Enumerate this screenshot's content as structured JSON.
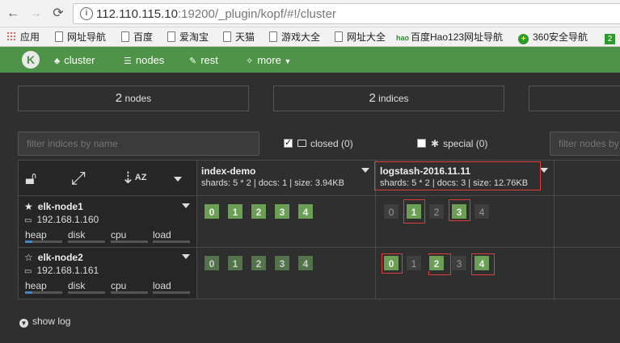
{
  "browser": {
    "url_host": "112.110.115.10",
    "url_rest": ":19200/_plugin/kopf/#!/cluster",
    "bookmarks": [
      "应用",
      "网址导航",
      "百度",
      "爱淘宝",
      "天猫",
      "游戏大全",
      "网址大全",
      "百度Hao123网址导航",
      "360安全导航"
    ],
    "hao_badge": "hao",
    "s360_badge": "+",
    "s2_badge": "2"
  },
  "navbar": {
    "logo": "K",
    "items": [
      {
        "label": "cluster",
        "icon": "sitemap-icon"
      },
      {
        "label": "nodes",
        "icon": "list-icon"
      },
      {
        "label": "rest",
        "icon": "edit-icon"
      },
      {
        "label": "more",
        "icon": "magic-wand-icon"
      }
    ]
  },
  "stats": {
    "nodes_count": "2",
    "nodes_label": "nodes",
    "indices_count": "2",
    "indices_label": "indices"
  },
  "filters": {
    "indices_placeholder": "filter indices by name",
    "closed_label": "closed (0)",
    "special_label": "special (0)",
    "nodes_placeholder": "filter nodes by"
  },
  "indices": [
    {
      "name": "index-demo",
      "meta": "shards: 5 * 2 | docs: 1 | size: 3.94KB"
    },
    {
      "name": "logstash-2016.11.11",
      "meta": "shards: 5 * 2 | docs: 3 | size: 12.76KB"
    }
  ],
  "metric_labels": [
    "heap",
    "disk",
    "cpu",
    "load"
  ],
  "nodes": [
    {
      "name": "elk-node1",
      "ip": "192.168.1.160",
      "master": true,
      "heap_fraction": 0.2
    },
    {
      "name": "elk-node2",
      "ip": "192.168.1.161",
      "master": false,
      "heap_fraction": 0.2
    }
  ],
  "shards": {
    "labels": [
      "0",
      "1",
      "2",
      "3",
      "4"
    ],
    "node1_index_demo": [
      "primary",
      "primary",
      "primary",
      "primary",
      "primary"
    ],
    "node1_logstash": [
      "ghost",
      "primary",
      "ghost",
      "primary",
      "ghost"
    ],
    "node2_index_demo": [
      "replica",
      "replica",
      "replica",
      "replica",
      "replica"
    ],
    "node2_logstash": [
      "primary",
      "ghost",
      "primary",
      "ghost",
      "primary"
    ]
  },
  "footer": {
    "show_log": "show log"
  },
  "colors": {
    "navbar": "#4e9347",
    "primary_shard": "#6a9f55",
    "replica_shard": "#53744a",
    "highlight": "#e03a3a"
  }
}
